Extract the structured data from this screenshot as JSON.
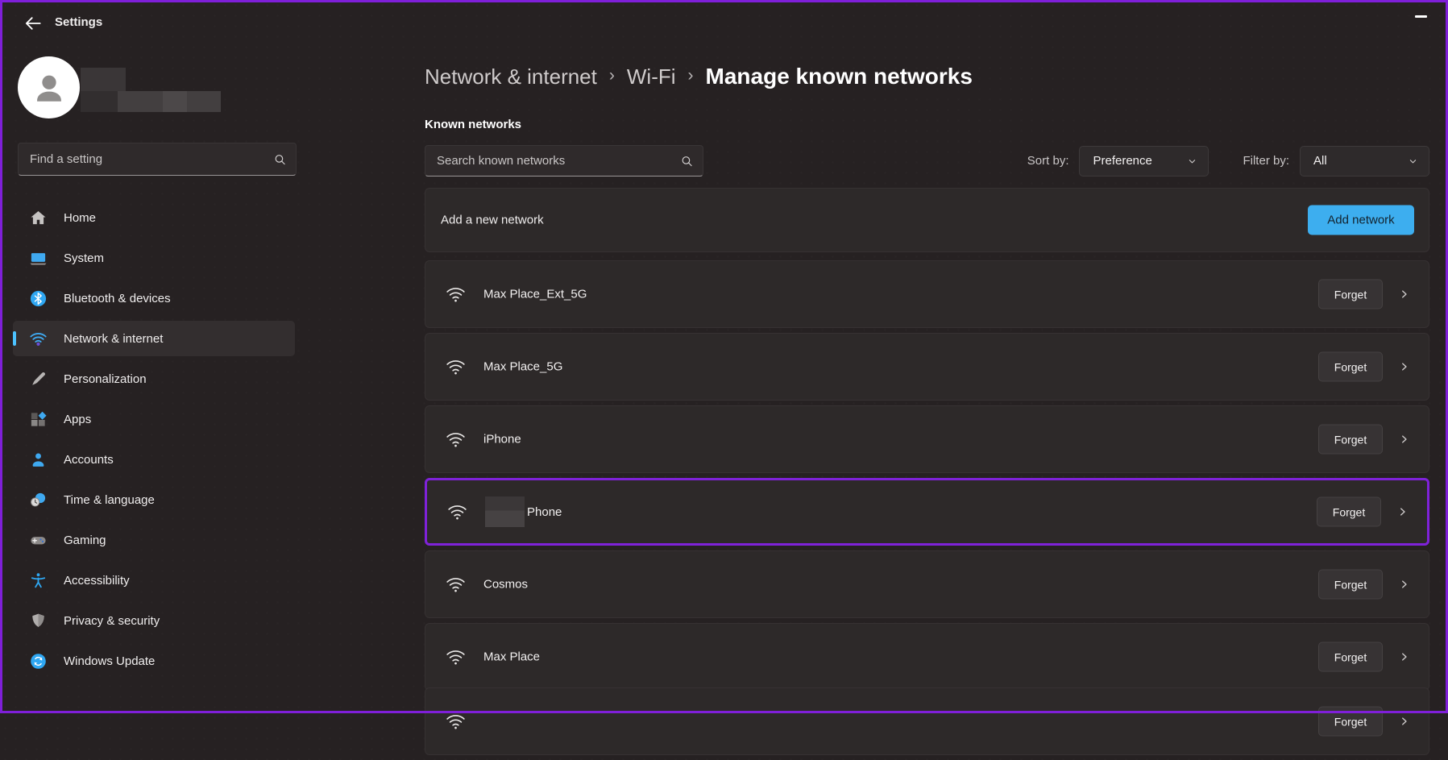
{
  "window": {
    "title": "Settings"
  },
  "sidebar": {
    "search_placeholder": "Find a setting",
    "items": [
      {
        "label": "Home",
        "icon": "home-icon",
        "selected": false
      },
      {
        "label": "System",
        "icon": "system-icon",
        "selected": false
      },
      {
        "label": "Bluetooth & devices",
        "icon": "bluetooth-icon",
        "selected": false
      },
      {
        "label": "Network & internet",
        "icon": "network-wifi-icon",
        "selected": true
      },
      {
        "label": "Personalization",
        "icon": "personalization-icon",
        "selected": false
      },
      {
        "label": "Apps",
        "icon": "apps-icon",
        "selected": false
      },
      {
        "label": "Accounts",
        "icon": "accounts-icon",
        "selected": false
      },
      {
        "label": "Time & language",
        "icon": "time-language-icon",
        "selected": false
      },
      {
        "label": "Gaming",
        "icon": "gaming-icon",
        "selected": false
      },
      {
        "label": "Accessibility",
        "icon": "accessibility-icon",
        "selected": false
      },
      {
        "label": "Privacy & security",
        "icon": "privacy-icon",
        "selected": false
      },
      {
        "label": "Windows Update",
        "icon": "windows-update-icon",
        "selected": false
      }
    ]
  },
  "breadcrumb": {
    "parts": [
      "Network & internet",
      "Wi-Fi"
    ],
    "separator": "›",
    "current": "Manage known networks"
  },
  "main": {
    "section_label": "Known networks",
    "search_placeholder": "Search known networks",
    "sort": {
      "label": "Sort by:",
      "value": "Preference"
    },
    "filter": {
      "label": "Filter by:",
      "value": "All"
    },
    "add_row": {
      "label": "Add a new network",
      "button": "Add network"
    },
    "forget_label": "Forget",
    "networks": [
      {
        "name": "Max Place_Ext_5G",
        "redacted_prefix": false,
        "highlighted": false
      },
      {
        "name": "Max Place_5G",
        "redacted_prefix": false,
        "highlighted": false
      },
      {
        "name": "iPhone",
        "redacted_prefix": false,
        "highlighted": false
      },
      {
        "name": "Phone",
        "redacted_prefix": true,
        "highlighted": true
      },
      {
        "name": "Cosmos",
        "redacted_prefix": false,
        "highlighted": false
      },
      {
        "name": "Max Place",
        "redacted_prefix": false,
        "highlighted": false
      }
    ],
    "partial_row": true
  },
  "colors": {
    "accent_blue": "#3daeef",
    "sidebar_accent_pill": "#4cc2ff",
    "highlight_purple": "#7f22d9",
    "frame_purple": "#7f1fd9",
    "card_background": "#2d2929",
    "page_background": "#262122"
  }
}
